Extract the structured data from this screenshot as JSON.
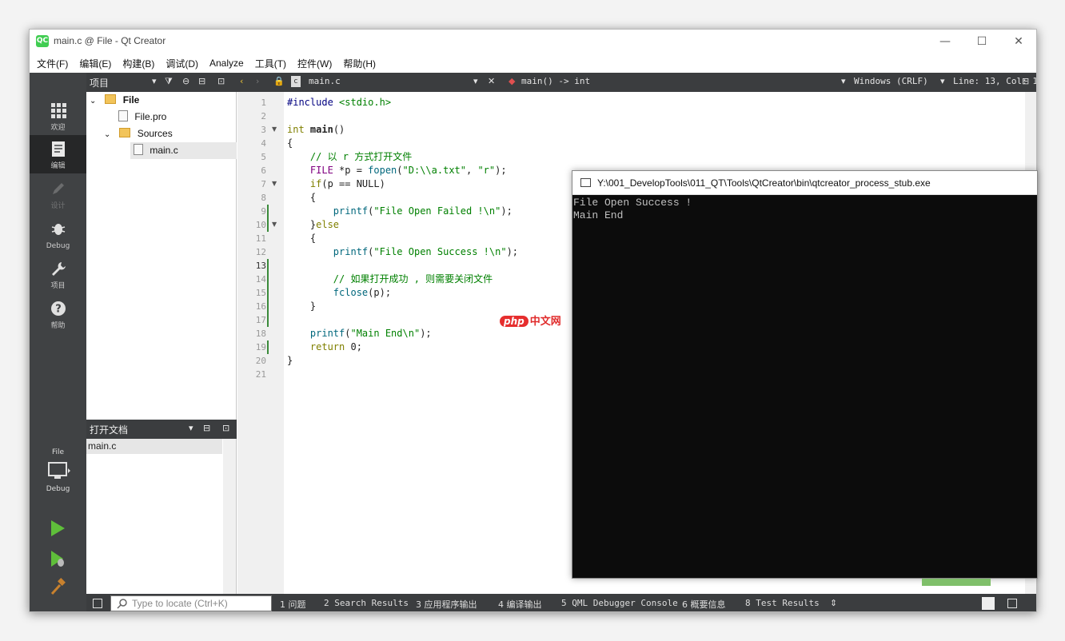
{
  "window": {
    "title": "main.c @ File - Qt Creator",
    "logo": "QC",
    "controls": {
      "minimize": "—",
      "maximize": "☐",
      "close": "✕"
    }
  },
  "menu": [
    "文件(F)",
    "编辑(E)",
    "构建(B)",
    "调试(D)",
    "Analyze",
    "工具(T)",
    "控件(W)",
    "帮助(H)"
  ],
  "modes": [
    {
      "label": "欢迎",
      "icon": "welcome-grid-icon"
    },
    {
      "label": "编辑",
      "icon": "edit-document-icon"
    },
    {
      "label": "设计",
      "icon": "design-pencil-icon"
    },
    {
      "label": "Debug",
      "icon": "debug-bug-icon"
    },
    {
      "label": "项目",
      "icon": "wrench-icon"
    },
    {
      "label": "帮助",
      "icon": "help-icon"
    }
  ],
  "kit": {
    "project": "File",
    "config": "Debug"
  },
  "toolstrip": {
    "panel_title": "项目",
    "file_name": "main.c",
    "symbol": "main() -> int",
    "line_ending": "Windows (CRLF)",
    "position": "Line: 13, Col: 1"
  },
  "tree": {
    "root": "File",
    "pro_file": "File.pro",
    "sources": "Sources",
    "main_file": "main.c"
  },
  "open_docs": {
    "title": "打开文档",
    "items": [
      "main.c"
    ]
  },
  "code": {
    "lines": [
      "1",
      "2",
      "3",
      "4",
      "5",
      "6",
      "7",
      "8",
      "9",
      "10",
      "11",
      "12",
      "13",
      "14",
      "15",
      "16",
      "17",
      "18",
      "19",
      "20",
      "21"
    ],
    "l1_directive": "#include",
    "l1_header": "<stdio.h>",
    "l3_type": "int",
    "l3_func": "main",
    "l3_rest": "()",
    "l4": "{",
    "l5": "    // 以 r 方式打开文件",
    "l6_type": "    FILE",
    "l6_mid": " *p = ",
    "l6_fn": "fopen",
    "l6_open": "(",
    "l6_str1": "\"D:\\\\a.txt\"",
    "l6_comma": ", ",
    "l6_str2": "\"r\"",
    "l6_end": ");",
    "l7_kw": "    if",
    "l7_rest": "(p == NULL)",
    "l8": "    {",
    "l9_fn": "        printf",
    "l9_open": "(",
    "l9_str": "\"File Open Failed !\\n\"",
    "l9_end": ");",
    "l10_a": "    }",
    "l10_kw": "else",
    "l11": "    {",
    "l12_fn": "        printf",
    "l12_open": "(",
    "l12_str": "\"File Open Success !\\n\"",
    "l12_end": ");",
    "l14": "        // 如果打开成功 , 则需要关闭文件",
    "l15_fn": "        fclose",
    "l15_rest": "(p);",
    "l16": "    }",
    "l18_fn": "    printf",
    "l18_open": "(",
    "l18_str": "\"Main End\\n\"",
    "l18_end": ");",
    "l19_kw": "    return",
    "l19_rest": " 0;",
    "l20": "}"
  },
  "console": {
    "title": "Y:\\001_DevelopTools\\011_QT\\Tools\\QtCreator\\bin\\qtcreator_process_stub.exe",
    "output": [
      "File Open Success !",
      "Main End"
    ]
  },
  "watermark": {
    "badge": "php",
    "text": "中文网"
  },
  "status": {
    "locate_placeholder": "Type to locate (Ctrl+K)",
    "panes": [
      "1 问题",
      "2 Search Results",
      "3 应用程序输出",
      "4 编译输出",
      "5 QML Debugger Console",
      "6 概要信息",
      "8 Test Results"
    ]
  },
  "colors": {
    "sidebar": "#404244",
    "toolstrip": "#3b3d3f",
    "console_bg": "#0c0c0c",
    "accent_green": "#41cd52"
  }
}
